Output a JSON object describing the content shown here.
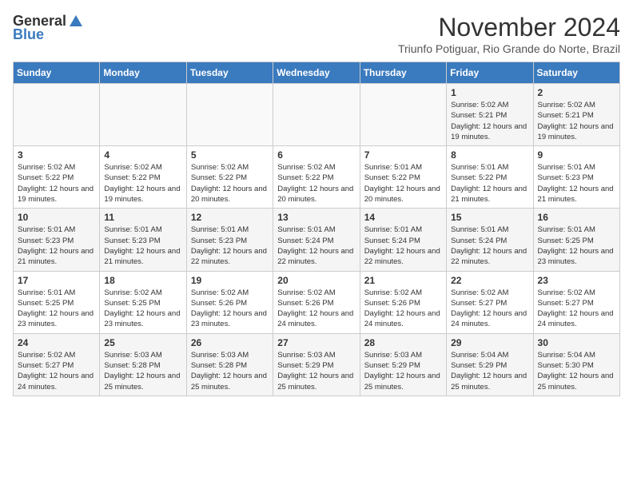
{
  "header": {
    "logo_general": "General",
    "logo_blue": "Blue",
    "month_title": "November 2024",
    "subtitle": "Triunfo Potiguar, Rio Grande do Norte, Brazil"
  },
  "days_of_week": [
    "Sunday",
    "Monday",
    "Tuesday",
    "Wednesday",
    "Thursday",
    "Friday",
    "Saturday"
  ],
  "weeks": [
    [
      {
        "day": "",
        "info": ""
      },
      {
        "day": "",
        "info": ""
      },
      {
        "day": "",
        "info": ""
      },
      {
        "day": "",
        "info": ""
      },
      {
        "day": "",
        "info": ""
      },
      {
        "day": "1",
        "info": "Sunrise: 5:02 AM\nSunset: 5:21 PM\nDaylight: 12 hours and 19 minutes."
      },
      {
        "day": "2",
        "info": "Sunrise: 5:02 AM\nSunset: 5:21 PM\nDaylight: 12 hours and 19 minutes."
      }
    ],
    [
      {
        "day": "3",
        "info": "Sunrise: 5:02 AM\nSunset: 5:22 PM\nDaylight: 12 hours and 19 minutes."
      },
      {
        "day": "4",
        "info": "Sunrise: 5:02 AM\nSunset: 5:22 PM\nDaylight: 12 hours and 19 minutes."
      },
      {
        "day": "5",
        "info": "Sunrise: 5:02 AM\nSunset: 5:22 PM\nDaylight: 12 hours and 20 minutes."
      },
      {
        "day": "6",
        "info": "Sunrise: 5:02 AM\nSunset: 5:22 PM\nDaylight: 12 hours and 20 minutes."
      },
      {
        "day": "7",
        "info": "Sunrise: 5:01 AM\nSunset: 5:22 PM\nDaylight: 12 hours and 20 minutes."
      },
      {
        "day": "8",
        "info": "Sunrise: 5:01 AM\nSunset: 5:22 PM\nDaylight: 12 hours and 21 minutes."
      },
      {
        "day": "9",
        "info": "Sunrise: 5:01 AM\nSunset: 5:23 PM\nDaylight: 12 hours and 21 minutes."
      }
    ],
    [
      {
        "day": "10",
        "info": "Sunrise: 5:01 AM\nSunset: 5:23 PM\nDaylight: 12 hours and 21 minutes."
      },
      {
        "day": "11",
        "info": "Sunrise: 5:01 AM\nSunset: 5:23 PM\nDaylight: 12 hours and 21 minutes."
      },
      {
        "day": "12",
        "info": "Sunrise: 5:01 AM\nSunset: 5:23 PM\nDaylight: 12 hours and 22 minutes."
      },
      {
        "day": "13",
        "info": "Sunrise: 5:01 AM\nSunset: 5:24 PM\nDaylight: 12 hours and 22 minutes."
      },
      {
        "day": "14",
        "info": "Sunrise: 5:01 AM\nSunset: 5:24 PM\nDaylight: 12 hours and 22 minutes."
      },
      {
        "day": "15",
        "info": "Sunrise: 5:01 AM\nSunset: 5:24 PM\nDaylight: 12 hours and 22 minutes."
      },
      {
        "day": "16",
        "info": "Sunrise: 5:01 AM\nSunset: 5:25 PM\nDaylight: 12 hours and 23 minutes."
      }
    ],
    [
      {
        "day": "17",
        "info": "Sunrise: 5:01 AM\nSunset: 5:25 PM\nDaylight: 12 hours and 23 minutes."
      },
      {
        "day": "18",
        "info": "Sunrise: 5:02 AM\nSunset: 5:25 PM\nDaylight: 12 hours and 23 minutes."
      },
      {
        "day": "19",
        "info": "Sunrise: 5:02 AM\nSunset: 5:26 PM\nDaylight: 12 hours and 23 minutes."
      },
      {
        "day": "20",
        "info": "Sunrise: 5:02 AM\nSunset: 5:26 PM\nDaylight: 12 hours and 24 minutes."
      },
      {
        "day": "21",
        "info": "Sunrise: 5:02 AM\nSunset: 5:26 PM\nDaylight: 12 hours and 24 minutes."
      },
      {
        "day": "22",
        "info": "Sunrise: 5:02 AM\nSunset: 5:27 PM\nDaylight: 12 hours and 24 minutes."
      },
      {
        "day": "23",
        "info": "Sunrise: 5:02 AM\nSunset: 5:27 PM\nDaylight: 12 hours and 24 minutes."
      }
    ],
    [
      {
        "day": "24",
        "info": "Sunrise: 5:02 AM\nSunset: 5:27 PM\nDaylight: 12 hours and 24 minutes."
      },
      {
        "day": "25",
        "info": "Sunrise: 5:03 AM\nSunset: 5:28 PM\nDaylight: 12 hours and 25 minutes."
      },
      {
        "day": "26",
        "info": "Sunrise: 5:03 AM\nSunset: 5:28 PM\nDaylight: 12 hours and 25 minutes."
      },
      {
        "day": "27",
        "info": "Sunrise: 5:03 AM\nSunset: 5:29 PM\nDaylight: 12 hours and 25 minutes."
      },
      {
        "day": "28",
        "info": "Sunrise: 5:03 AM\nSunset: 5:29 PM\nDaylight: 12 hours and 25 minutes."
      },
      {
        "day": "29",
        "info": "Sunrise: 5:04 AM\nSunset: 5:29 PM\nDaylight: 12 hours and 25 minutes."
      },
      {
        "day": "30",
        "info": "Sunrise: 5:04 AM\nSunset: 5:30 PM\nDaylight: 12 hours and 25 minutes."
      }
    ]
  ]
}
